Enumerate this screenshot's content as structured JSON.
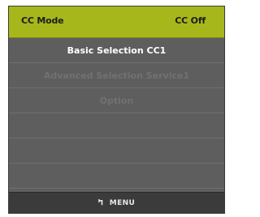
{
  "header": {
    "label": "CC Mode",
    "value": "CC Off",
    "accent_color": "#a6b71c"
  },
  "menu": {
    "items": [
      {
        "label": "Basic Selection CC1",
        "state": "selected"
      },
      {
        "label": "Advanced Selection Service1",
        "state": "disabled"
      },
      {
        "label": "Option",
        "state": "disabled"
      },
      {
        "label": "",
        "state": "empty"
      },
      {
        "label": "",
        "state": "empty"
      },
      {
        "label": "",
        "state": "empty"
      }
    ]
  },
  "footer": {
    "menu_label": "MENU",
    "icon": "return-arrow-icon"
  }
}
